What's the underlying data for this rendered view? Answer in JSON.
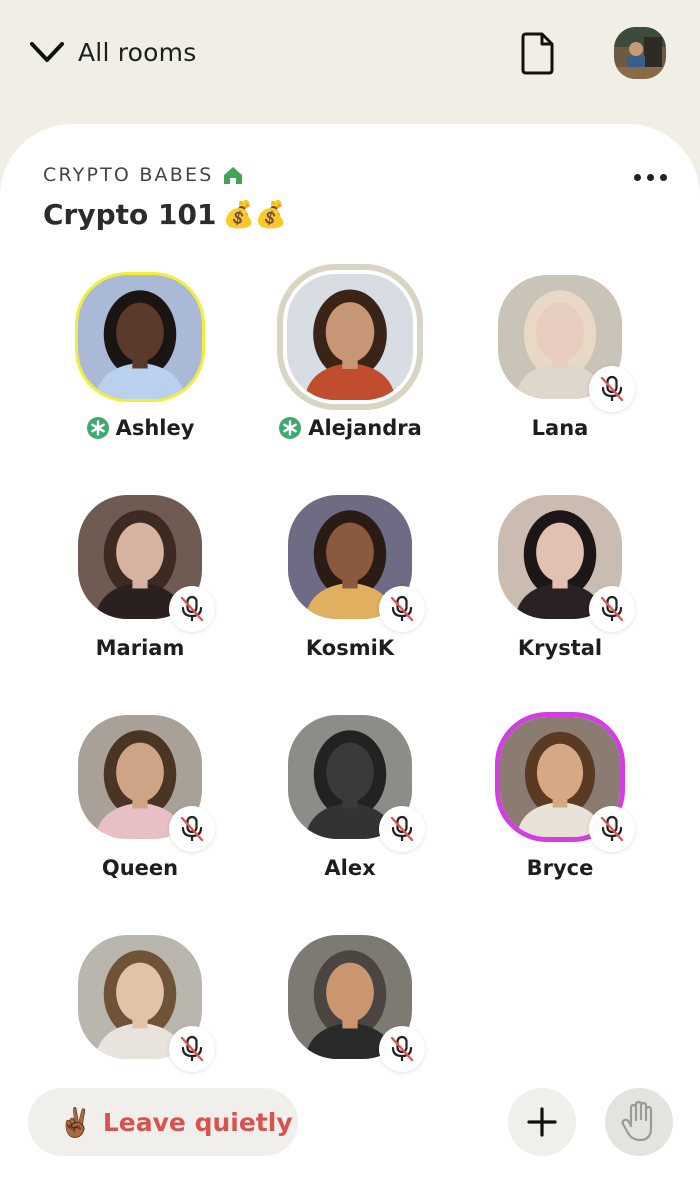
{
  "header": {
    "back_label": "All rooms",
    "doc_icon": "document-icon",
    "profile_icon": "profile-avatar"
  },
  "room": {
    "club_name": "CRYPTO BABES",
    "title": "Crypto 101",
    "title_emoji": "💰💰"
  },
  "speakers": [
    {
      "name": "Ashley",
      "moderator": true,
      "muted": false,
      "ring": "yellow",
      "bg": "#a9b9d6",
      "skin": "#5a3a2a",
      "hair": "#1a1412",
      "shirt": "#b9d0ef"
    },
    {
      "name": "Alejandra",
      "moderator": true,
      "muted": false,
      "ring": "speaking",
      "bg": "#d8dde4",
      "skin": "#c79677",
      "hair": "#3a2418",
      "shirt": "#c04d2e"
    },
    {
      "name": "Lana",
      "moderator": false,
      "muted": true,
      "ring": "none",
      "bg": "#c9c3b8",
      "skin": "#e6cdbf",
      "hair": "#e9d8c5",
      "shirt": "#dfd6cc"
    },
    {
      "name": "Mariam",
      "moderator": false,
      "muted": true,
      "ring": "none",
      "bg": "#6f5b52",
      "skin": "#d6b2a0",
      "hair": "#3d2a22",
      "shirt": "#2b2020"
    },
    {
      "name": "KosmiK",
      "moderator": false,
      "muted": true,
      "ring": "none",
      "bg": "#6e6b84",
      "skin": "#8a5a3e",
      "hair": "#2a1c14",
      "shirt": "#e0b060"
    },
    {
      "name": "Krystal",
      "moderator": false,
      "muted": true,
      "ring": "none",
      "bg": "#cbbcb2",
      "skin": "#e1c2b2",
      "hair": "#1d1616",
      "shirt": "#2a2222"
    },
    {
      "name": "Queen",
      "moderator": false,
      "muted": true,
      "ring": "none",
      "bg": "#a9a198",
      "skin": "#cfa486",
      "hair": "#4a3424",
      "shirt": "#e6c0c4"
    },
    {
      "name": "Alex",
      "moderator": false,
      "muted": true,
      "ring": "none",
      "bg": "#8d8c88",
      "skin": "#3a3a3a",
      "hair": "#222222",
      "shirt": "#333333"
    },
    {
      "name": "Bryce",
      "moderator": false,
      "muted": true,
      "ring": "magenta",
      "bg": "#8a7c70",
      "skin": "#d6a883",
      "hair": "#5a3a22",
      "shirt": "#e7e1d8"
    },
    {
      "name": "",
      "moderator": false,
      "muted": true,
      "ring": "none",
      "bg": "#b9b6ae",
      "skin": "#e2c3a8",
      "hair": "#6f5338",
      "shirt": "#e8e4dd"
    },
    {
      "name": "",
      "moderator": false,
      "muted": true,
      "ring": "none",
      "bg": "#7d7a74",
      "skin": "#c9966f",
      "hair": "#4a4540",
      "shirt": "#2a2a2a"
    }
  ],
  "footer": {
    "leave_emoji": "✌🏾",
    "leave_label": "Leave quietly",
    "add_icon": "plus-icon",
    "hand_icon": "raise-hand-icon"
  },
  "colors": {
    "background": "#f1efe5",
    "sheet": "#ffffff",
    "leave_text": "#d6544f",
    "moderator_green": "#3faa6d",
    "home_green": "#44a35a",
    "mute_red": "#e05555"
  }
}
